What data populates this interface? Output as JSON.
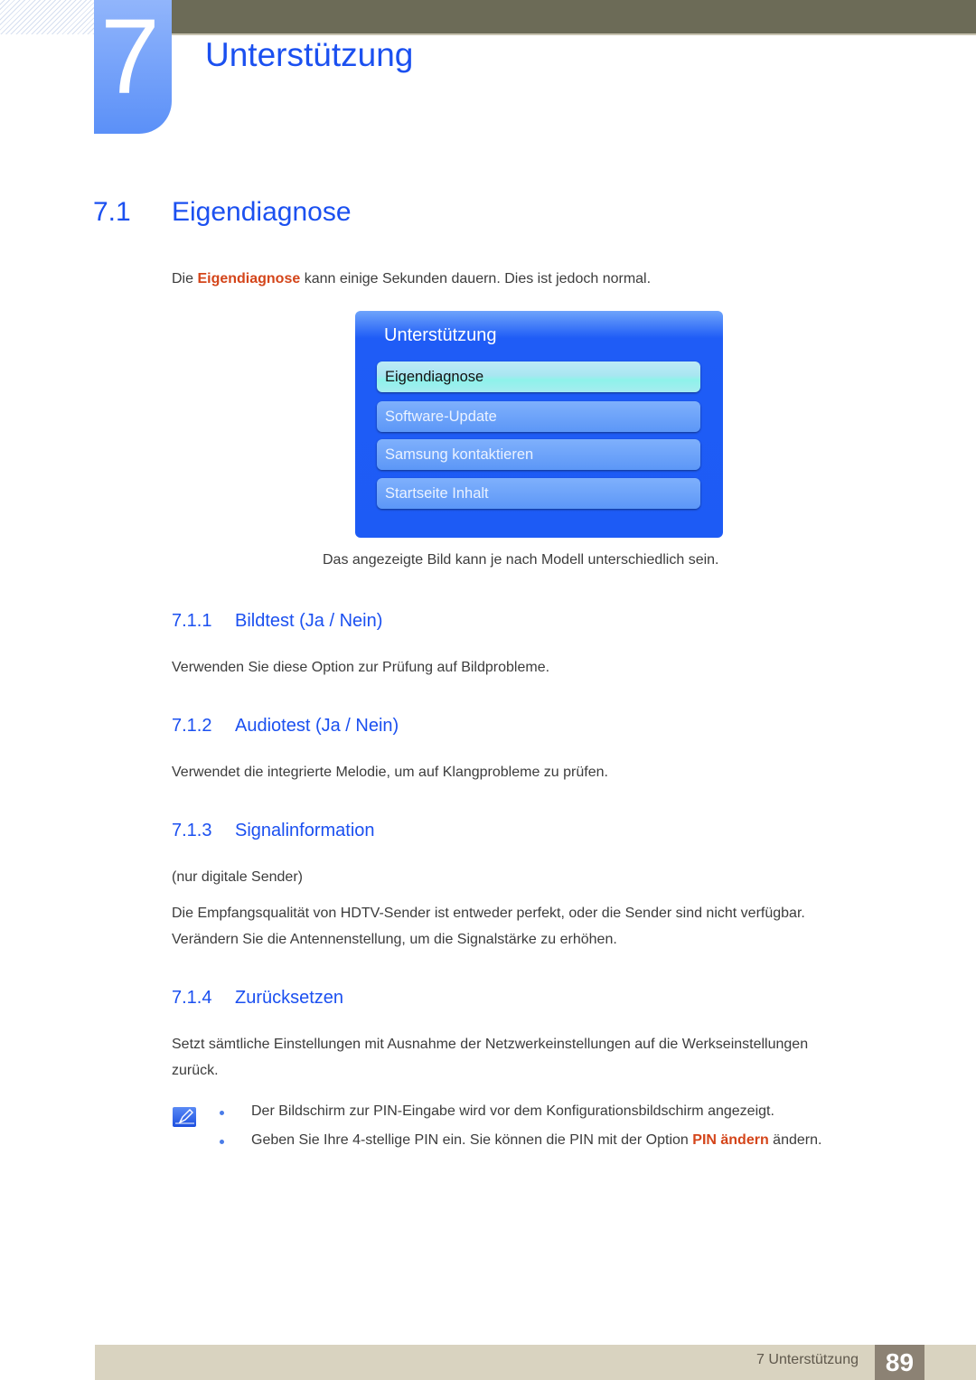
{
  "header": {
    "chapter_number": "7",
    "chapter_title": "Unterstützung"
  },
  "section": {
    "number": "7.1",
    "title": "Eigendiagnose",
    "intro_prefix": "Die ",
    "intro_highlight": "Eigendiagnose",
    "intro_suffix": " kann einige Sekunden dauern. Dies ist jedoch normal."
  },
  "menu_screenshot": {
    "title": "Unterstützung",
    "items": [
      {
        "label": "Eigendiagnose",
        "selected": true
      },
      {
        "label": "Software-Update",
        "selected": false
      },
      {
        "label": "Samsung kontaktieren",
        "selected": false
      },
      {
        "label": "Startseite Inhalt",
        "selected": false
      }
    ],
    "caption": "Das angezeigte Bild kann je nach Modell unterschiedlich sein."
  },
  "subsections": [
    {
      "number": "7.1.1",
      "title": "Bildtest (Ja / Nein)",
      "text": "Verwenden Sie diese Option zur Prüfung auf Bildprobleme."
    },
    {
      "number": "7.1.2",
      "title": "Audiotest (Ja / Nein)",
      "text": "Verwendet die integrierte Melodie, um auf Klangprobleme zu prüfen."
    },
    {
      "number": "7.1.3",
      "title": "Signalinformation",
      "note": "(nur digitale Sender)",
      "text_line1": "Die Empfangsqualität von HDTV-Sender ist entweder perfekt, oder die Sender sind nicht verfügbar.",
      "text_line2": "Verändern Sie die Antennenstellung, um die Signalstärke zu erhöhen."
    },
    {
      "number": "7.1.4",
      "title": "Zurücksetzen",
      "text_line1": "Setzt sämtliche Einstellungen mit Ausnahme der Netzwerkeinstellungen auf die Werkseinstellungen",
      "text_line2": "zurück."
    }
  ],
  "notes": {
    "icon": "note-pencil-icon",
    "bullets": [
      {
        "text": "Der Bildschirm zur PIN-Eingabe wird vor dem Konfigurationsbildschirm angezeigt."
      },
      {
        "prefix": "Geben Sie Ihre 4-stellige PIN ein. Sie können die PIN mit der Option ",
        "highlight": "PIN ändern",
        "suffix": " ändern."
      }
    ]
  },
  "footer": {
    "label": "7 Unterstützung",
    "page_number": "89"
  },
  "colors": {
    "heading_blue": "#1b50f0",
    "highlight_orange": "#d4451a",
    "topbar": "#6c6b57",
    "footer_bg": "#d9d3c0",
    "page_num_bg": "#8c8274"
  }
}
